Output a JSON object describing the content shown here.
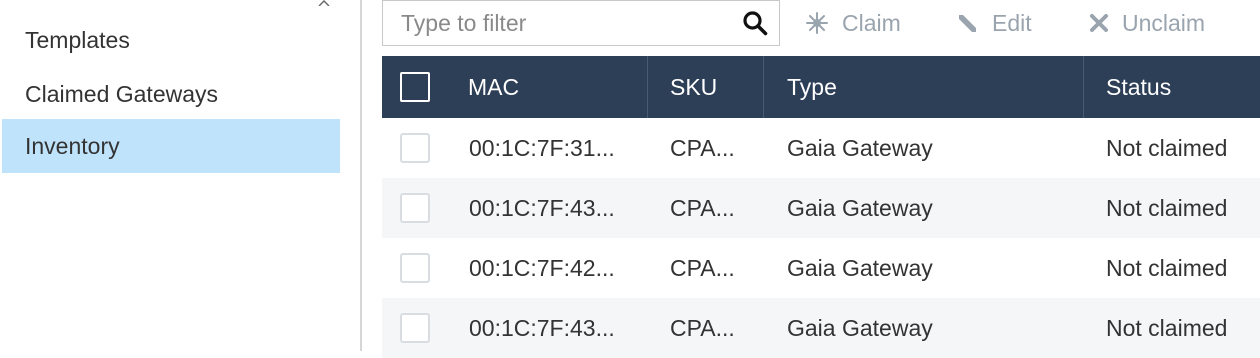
{
  "sidebar": {
    "items": [
      {
        "label": "Templates",
        "active": false
      },
      {
        "label": "Claimed Gateways",
        "active": false
      },
      {
        "label": "Inventory",
        "active": true
      }
    ]
  },
  "toolbar": {
    "filter_placeholder": "Type to filter",
    "claim_label": "Claim",
    "edit_label": "Edit",
    "unclaim_label": "Unclaim"
  },
  "table": {
    "columns": [
      "MAC",
      "SKU",
      "Type",
      "Status"
    ],
    "rows": [
      {
        "mac": "00:1C:7F:31...",
        "sku": "CPA...",
        "type": "Gaia Gateway",
        "status": "Not claimed"
      },
      {
        "mac": "00:1C:7F:43...",
        "sku": "CPA...",
        "type": "Gaia Gateway",
        "status": "Not claimed"
      },
      {
        "mac": "00:1C:7F:42...",
        "sku": "CPA...",
        "type": "Gaia Gateway",
        "status": "Not claimed"
      },
      {
        "mac": "00:1C:7F:43...",
        "sku": "CPA...",
        "type": "Gaia Gateway",
        "status": "Not claimed"
      }
    ]
  },
  "colors": {
    "header_bg": "#2d3e57",
    "active_nav_bg": "#bfe3fb",
    "alt_row_bg": "#f4f6f8",
    "disabled_action": "#9aa4ae"
  },
  "icons": {
    "search": "search-icon",
    "claim": "sparkle-icon",
    "edit": "pencil-icon",
    "unclaim": "close-icon",
    "sidebar_caret": "chevron-up-icon"
  }
}
